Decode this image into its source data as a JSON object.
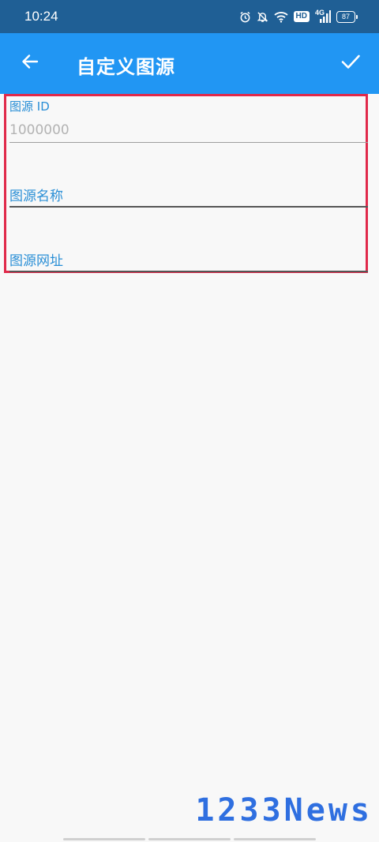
{
  "status_bar": {
    "time": "10:24",
    "hd": "HD",
    "network": "4G",
    "battery": "87",
    "icons": [
      "alarm-icon",
      "mute-bell-icon",
      "wifi-icon",
      "hd-icon",
      "signal-icon",
      "battery-icon"
    ]
  },
  "toolbar": {
    "title": "自定义图源",
    "back_icon": "arrow-left-icon",
    "confirm_icon": "check-icon"
  },
  "form": {
    "source_id": {
      "label": "图源 ID",
      "value": "",
      "placeholder": "1000000"
    },
    "source_name": {
      "label": "图源名称",
      "value": "",
      "placeholder": ""
    },
    "source_url": {
      "label": "图源网址",
      "value": "",
      "placeholder": ""
    }
  },
  "watermark": {
    "text": "1233News"
  },
  "colors": {
    "status_bar": "#1f5f95",
    "toolbar": "#2196f3",
    "accent_label": "#2a8fd6",
    "highlight_border": "#e0294a",
    "watermark": "#2f6fe0"
  }
}
